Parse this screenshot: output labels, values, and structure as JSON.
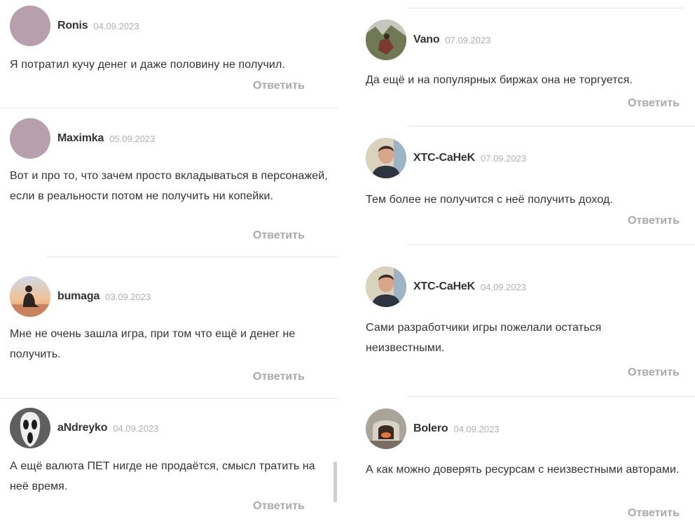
{
  "reply_label": "Ответить",
  "colors": {
    "text": "#333333",
    "muted": "#a9a9a9",
    "date": "#b0b0b0",
    "separator": "#e4e4e4",
    "placeholder_avatar": "#b79fae"
  },
  "left": [
    {
      "author": "Ronis",
      "date": "04.09.2023",
      "avatar": "placeholder-avatar",
      "text": "Я потратил кучу денег и даже половину не получил."
    },
    {
      "author": "Maximka",
      "date": "05.09.2023",
      "avatar": "placeholder-avatar",
      "text": "Вот и про то, что зачем просто вкладываться в персонажей, если в реальности потом не получить ни копейки."
    },
    {
      "author": "bumaga",
      "date": "03.09.2023",
      "avatar": "silhouette-sunset-avatar",
      "text": "Мне не очень зашла игра, при том что ещё и денег не получить."
    },
    {
      "author": "aNdreyko",
      "date": "04.09.2023",
      "avatar": "ghostface-mask-avatar",
      "text": "А ещё валюта ПЕТ нигде не продаётся, смысл тратить на неё время."
    }
  ],
  "right": [
    {
      "author": "Vano",
      "date": "07.09.2023",
      "avatar": "outdoor-photo-avatar",
      "text": "Да ещё и на популярных биржах она не торгуется."
    },
    {
      "author": "XTC-CaHeK",
      "date": "07.09.2023",
      "avatar": "man-portrait-avatar",
      "text": "Тем более не получится с неё получить доход."
    },
    {
      "author": "XTC-CaHeK",
      "date": "04.09.2023",
      "avatar": "man-portrait-avatar",
      "text": "Сами разработчики игры пожелали остаться неизвестными."
    },
    {
      "author": "Bolero",
      "date": "04.09.2023",
      "avatar": "oven-photo-avatar",
      "text": "А как можно доверять ресурсам с неизвестными авторами."
    }
  ]
}
